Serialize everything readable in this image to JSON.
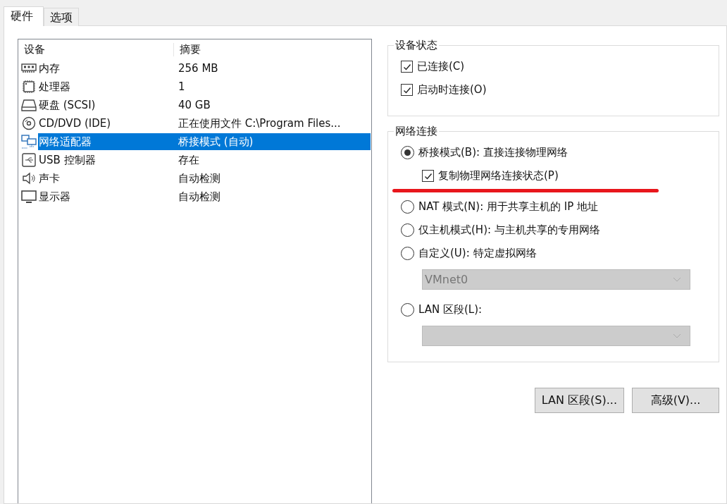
{
  "tabs": [
    {
      "label": "硬件",
      "selected": true
    },
    {
      "label": "选项",
      "selected": false
    }
  ],
  "device_list": {
    "columns": [
      "设备",
      "摘要"
    ],
    "rows": [
      {
        "kind": "memory",
        "device": "内存",
        "summary": "256 MB",
        "selected": false
      },
      {
        "kind": "cpu",
        "device": "处理器",
        "summary": "1",
        "selected": false
      },
      {
        "kind": "disk",
        "device": "硬盘 (SCSI)",
        "summary": "40 GB",
        "selected": false
      },
      {
        "kind": "cd",
        "device": "CD/DVD (IDE)",
        "summary": "正在使用文件 C:\\Program Files...",
        "selected": false
      },
      {
        "kind": "network",
        "device": "网络适配器",
        "summary": "桥接模式 (自动)",
        "selected": true
      },
      {
        "kind": "usb",
        "device": "USB 控制器",
        "summary": "存在",
        "selected": false
      },
      {
        "kind": "sound",
        "device": "声卡",
        "summary": "自动检测",
        "selected": false
      },
      {
        "kind": "display",
        "device": "显示器",
        "summary": "自动检测",
        "selected": false
      }
    ]
  },
  "device_status": {
    "title": "设备状态",
    "items": [
      {
        "label": "已连接(C)",
        "checked": true
      },
      {
        "label": "启动时连接(O)",
        "checked": true
      }
    ]
  },
  "network_connection": {
    "title": "网络连接",
    "items": [
      {
        "kind": "radio",
        "label": "桥接模式(B): 直接连接物理网络",
        "selected": true
      },
      {
        "kind": "checkbox",
        "label": "复制物理网络连接状态(P)",
        "checked": true,
        "underlined": true
      },
      {
        "kind": "radio",
        "label": "NAT 模式(N): 用于共享主机的 IP 地址",
        "selected": false
      },
      {
        "kind": "radio",
        "label": "仅主机模式(H): 与主机共享的专用网络",
        "selected": false
      },
      {
        "kind": "radio",
        "label": "自定义(U): 特定虚拟网络",
        "selected": false
      },
      {
        "kind": "dropdown",
        "value": "VMnet0",
        "disabled": true
      },
      {
        "kind": "radio",
        "label": "LAN 区段(L):",
        "selected": false
      },
      {
        "kind": "dropdown",
        "disabled": true
      }
    ]
  },
  "buttons": [
    "LAN 区段(S)...",
    "高级(V)..."
  ]
}
